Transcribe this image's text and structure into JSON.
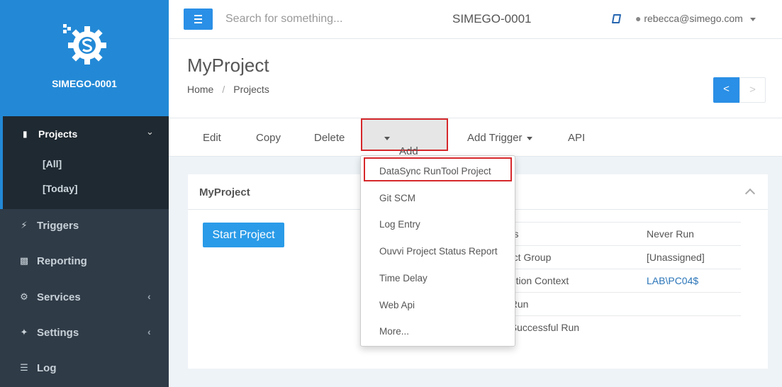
{
  "colors": {
    "accent": "#2a8fe6",
    "sidebar": "#2f3b47",
    "highlight_box": "#d6282b"
  },
  "sidebar": {
    "brand_name": "SIMEGO-0001",
    "active": {
      "label": "Projects",
      "icon": "book-icon",
      "subitems": [
        "[All]",
        "[Today]"
      ]
    },
    "items": [
      {
        "label": "Triggers",
        "icon": "bolt-icon"
      },
      {
        "label": "Reporting",
        "icon": "bar-chart-icon"
      },
      {
        "label": "Services",
        "icon": "cogs-icon"
      },
      {
        "label": "Settings",
        "icon": "magic-wand-icon"
      },
      {
        "label": "Log",
        "icon": "list-icon"
      }
    ]
  },
  "header": {
    "search_placeholder": "Search for something...",
    "center_title": "SIMEGO-0001",
    "user": "rebecca@simego.com"
  },
  "page": {
    "title": "MyProject",
    "breadcrumb": [
      "Home",
      "Projects"
    ],
    "pager_prev": "<",
    "pager_next": ">"
  },
  "toolbar": {
    "edit": "Edit",
    "copy": "Copy",
    "delete": "Delete",
    "add_step": "Add Step",
    "add_trigger": "Add Trigger",
    "api": "API"
  },
  "dropdown": {
    "items": [
      "DataSync RunTool Project",
      "Git SCM",
      "Log Entry",
      "Ouvvi Project Status Report",
      "Time Delay",
      "Web Api",
      "More..."
    ]
  },
  "panel": {
    "title": "MyProject",
    "start_button": "Start Project",
    "rows": [
      {
        "key": "atus",
        "value": "Never Run"
      },
      {
        "key": "oject Group",
        "value": "[Unassigned]"
      },
      {
        "key": "ecution Context",
        "value": "LAB\\PC04$"
      },
      {
        "key": "st Run",
        "value": ""
      },
      {
        "key": "st Successful Run",
        "value": ""
      }
    ]
  }
}
